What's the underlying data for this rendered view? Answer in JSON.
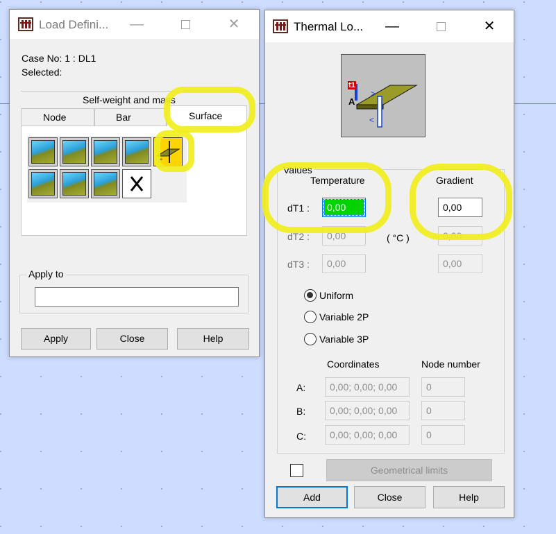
{
  "load_window": {
    "title": "Load Defini...",
    "case_label": "Case No: 1 : DL1",
    "selected_label": "Selected:",
    "tab_group_top": "Self-weight and mass",
    "tabs": [
      "Node",
      "Bar",
      "Surface"
    ],
    "active_tab": "Surface",
    "apply_to_label": "Apply to",
    "apply_to_value": "",
    "buttons": {
      "apply": "Apply",
      "close": "Close",
      "help": "Help"
    },
    "tool_icons": [
      "surface-load-uniform-icon",
      "surface-load-point-icon",
      "surface-load-linear-icon",
      "surface-load-hydrostatic-icon",
      "thermal-load-icon",
      "surface-load-3p-icon",
      "surface-load-contour-icon",
      "surface-load-edge-icon",
      "delete-load-icon"
    ]
  },
  "thermal_window": {
    "title": "Thermal Lo...",
    "values_group": "Values",
    "col_temperature": "Temperature",
    "col_gradient": "Gradient",
    "unit": "( °C )",
    "rows": [
      {
        "label": "dT1 :",
        "temperature": "0,00",
        "gradient": "0,00"
      },
      {
        "label": "dT2 :",
        "temperature": "0,00",
        "gradient": "0,00"
      },
      {
        "label": "dT3 :",
        "temperature": "0,00",
        "gradient": "0,00"
      }
    ],
    "distribution": [
      "Uniform",
      "Variable 2P",
      "Variable 3P"
    ],
    "selected_distribution": "Uniform",
    "col_coordinates": "Coordinates",
    "col_node_number": "Node number",
    "points": [
      {
        "label": "A:",
        "coords": "0,00; 0,00; 0,00",
        "node": "0"
      },
      {
        "label": "B:",
        "coords": "0,00; 0,00; 0,00",
        "node": "0"
      },
      {
        "label": "C:",
        "coords": "0,00; 0,00; 0,00",
        "node": "0"
      }
    ],
    "geometrical_limits": "Geometrical limits",
    "preview_labels": {
      "t1": "t1",
      "a": "A"
    },
    "buttons": {
      "add": "Add",
      "close": "Close",
      "help": "Help"
    }
  },
  "colors": {
    "highlight": "#f0ee1e",
    "selection": "#0078d7",
    "active_field_fill": "#00d400"
  }
}
